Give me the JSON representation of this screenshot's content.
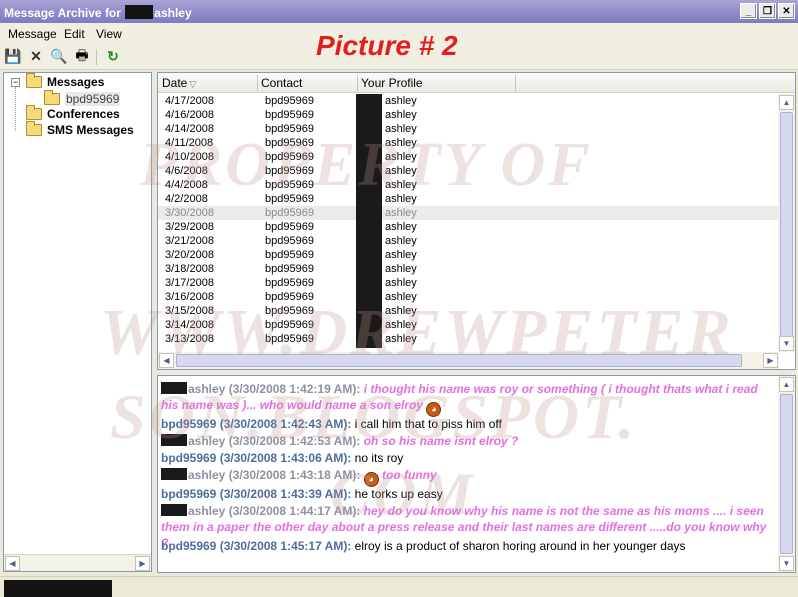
{
  "window": {
    "title_prefix": "Message Archive for",
    "title_user": "ashley",
    "btn_minimize": "_",
    "btn_restore": "❐",
    "btn_close": "✕"
  },
  "menu": [
    "Message",
    "Edit",
    "View"
  ],
  "toolbar": {
    "icons": [
      "save-icon",
      "delete-icon",
      "find-icon",
      "print-icon",
      "refresh-icon"
    ],
    "glyphs": [
      "💾",
      "✕",
      "🔍",
      "🖶",
      "↻"
    ]
  },
  "overlay_title": "Picture # 2",
  "tree": {
    "messages": "Messages",
    "contact": "bpd95969",
    "conferences": "Conferences",
    "sms": "SMS Messages",
    "expander": "−"
  },
  "grid": {
    "headers": {
      "date": "Date",
      "contact": "Contact",
      "profile": "Your Profile"
    },
    "sort_indicator": "▽",
    "rows": [
      {
        "date": "4/17/2008",
        "contact": "bpd95969",
        "profile": "ashley"
      },
      {
        "date": "4/16/2008",
        "contact": "bpd95969",
        "profile": "ashley"
      },
      {
        "date": "4/14/2008",
        "contact": "bpd95969",
        "profile": "ashley"
      },
      {
        "date": "4/11/2008",
        "contact": "bpd95969",
        "profile": "ashley"
      },
      {
        "date": "4/10/2008",
        "contact": "bpd95969",
        "profile": "ashley"
      },
      {
        "date": "4/6/2008",
        "contact": "bpd95969",
        "profile": "ashley"
      },
      {
        "date": "4/4/2008",
        "contact": "bpd95969",
        "profile": "ashley"
      },
      {
        "date": "4/2/2008",
        "contact": "bpd95969",
        "profile": "ashley"
      },
      {
        "date": "3/30/2008",
        "contact": "bpd95969",
        "profile": "ashley"
      },
      {
        "date": "3/29/2008",
        "contact": "bpd95969",
        "profile": "ashley"
      },
      {
        "date": "3/21/2008",
        "contact": "bpd95969",
        "profile": "ashley"
      },
      {
        "date": "3/20/2008",
        "contact": "bpd95969",
        "profile": "ashley"
      },
      {
        "date": "3/18/2008",
        "contact": "bpd95969",
        "profile": "ashley"
      },
      {
        "date": "3/17/2008",
        "contact": "bpd95969",
        "profile": "ashley"
      },
      {
        "date": "3/16/2008",
        "contact": "bpd95969",
        "profile": "ashley"
      },
      {
        "date": "3/15/2008",
        "contact": "bpd95969",
        "profile": "ashley"
      },
      {
        "date": "3/14/2008",
        "contact": "bpd95969",
        "profile": "ashley"
      },
      {
        "date": "3/13/2008",
        "contact": "bpd95969",
        "profile": "ashley"
      }
    ],
    "selected_index": 8,
    "scroll_up": "▲",
    "scroll_down": "▼",
    "scroll_left": "◀",
    "scroll_right": "▶"
  },
  "conversation": [
    {
      "from": "ashley",
      "self": true,
      "time": "(3/30/2008 1:42:19 AM):",
      "text": "i thought his name was roy or something ( i thought thats what i read his name was )... who would name a son elroy",
      "emoji": true
    },
    {
      "from": "bpd95969",
      "self": false,
      "time": "(3/30/2008 1:42:43 AM):",
      "text": "i call him that to piss him off"
    },
    {
      "from": "ashley",
      "self": true,
      "time": "(3/30/2008 1:42:53 AM):",
      "text": "oh so his name isnt elroy ?"
    },
    {
      "from": "bpd95969",
      "self": false,
      "time": "(3/30/2008 1:43:06 AM):",
      "text": "no its roy"
    },
    {
      "from": "ashley",
      "self": true,
      "time": "(3/30/2008 1:43:18 AM):",
      "text": "too funny",
      "emoji_before": true
    },
    {
      "from": "bpd95969",
      "self": false,
      "time": "(3/30/2008 1:43:39 AM):",
      "text": "he torks up easy"
    },
    {
      "from": "ashley",
      "self": true,
      "time": "(3/30/2008 1:44:17 AM):",
      "text": "hey do you know why his name is not the same as his moms .... i seen them in a paper the other day about a press release and their last names are different .....do you know why ?"
    },
    {
      "from": "bpd95969",
      "self": false,
      "time": "(3/30/2008 1:45:17 AM):",
      "text": "elroy is a product of sharon horing around in her younger days"
    }
  ],
  "watermark": {
    "line1": "PROPERTY OF",
    "line2": "WWW.DREWPETER",
    "line3": "SON.BLOGSPOT.",
    "line4": "COM"
  },
  "colors": {
    "title_bar": "#8f8bc9",
    "sender_contact": "#4f6c9e",
    "my_text": "#e36fe3",
    "overlay_title": "#e0201e"
  }
}
